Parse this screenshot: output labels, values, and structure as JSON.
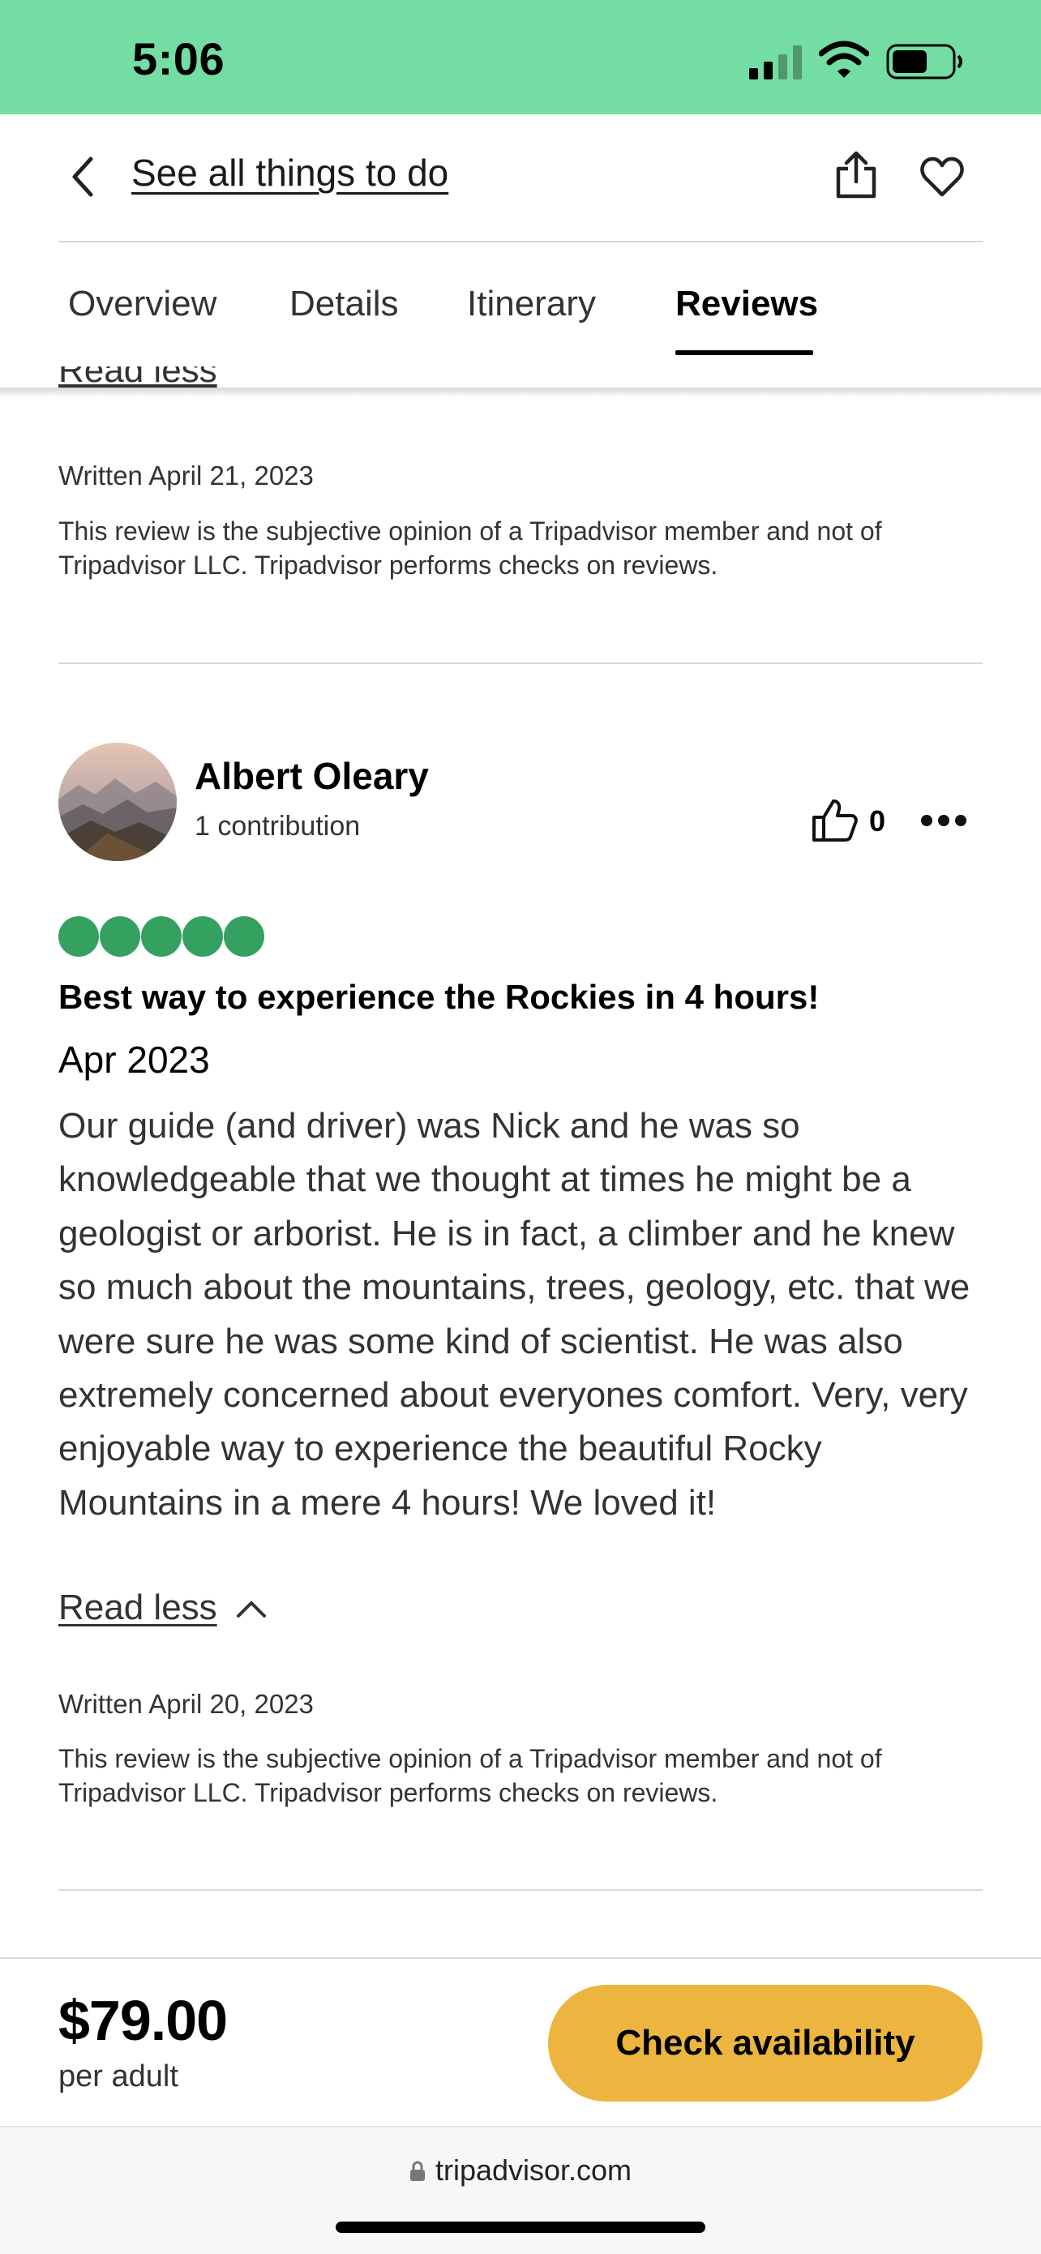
{
  "status_bar": {
    "time": "5:06",
    "icons": [
      "signal-icon",
      "wifi-icon",
      "battery-icon"
    ]
  },
  "header": {
    "back_icon": "chevron-left-icon",
    "link_text": "See all things to do",
    "share_icon": "share-icon",
    "save_icon": "heart-icon"
  },
  "tabs": [
    {
      "label": "Overview",
      "active": false
    },
    {
      "label": "Details",
      "active": false
    },
    {
      "label": "Itinerary",
      "active": false
    },
    {
      "label": "Reviews",
      "active": true
    }
  ],
  "previous_review": {
    "read_less_label": "Read less",
    "written": "Written April 21, 2023",
    "disclaimer": "This review is the subjective opinion of a Tripadvisor member and not of Tripadvisor LLC. Tripadvisor performs checks on reviews."
  },
  "review": {
    "reviewer_name": "Albert Oleary",
    "contributions": "1 contribution",
    "helpful_count": "0",
    "rating": 5,
    "rating_max": 5,
    "title": "Best way to experience the Rockies in 4 hours!",
    "date": "Apr 2023",
    "body": "Our guide (and driver) was Nick and he was so knowledgeable that we thought at times he might be a geologist or arborist. He is in fact, a climber and he knew so much about the mountains, trees, geology, etc. that we were sure he was some kind of scientist. He was also extremely concerned about everyones comfort. Very, very enjoyable way to experience the beautiful Rocky Mountains in a mere 4 hours! We loved it!",
    "read_less_label": "Read less",
    "written": "Written April 20, 2023",
    "disclaimer": "This review is the subjective opinion of a Tripadvisor member and not of Tripadvisor LLC. Tripadvisor performs checks on reviews."
  },
  "booking": {
    "price": "$79.00",
    "price_unit": "per adult",
    "cta_label": "Check availability"
  },
  "browser": {
    "url": "tripadvisor.com"
  },
  "colors": {
    "status_bar": "#74dda4",
    "rating_bubble": "#34a160",
    "cta": "#ebb53f"
  }
}
